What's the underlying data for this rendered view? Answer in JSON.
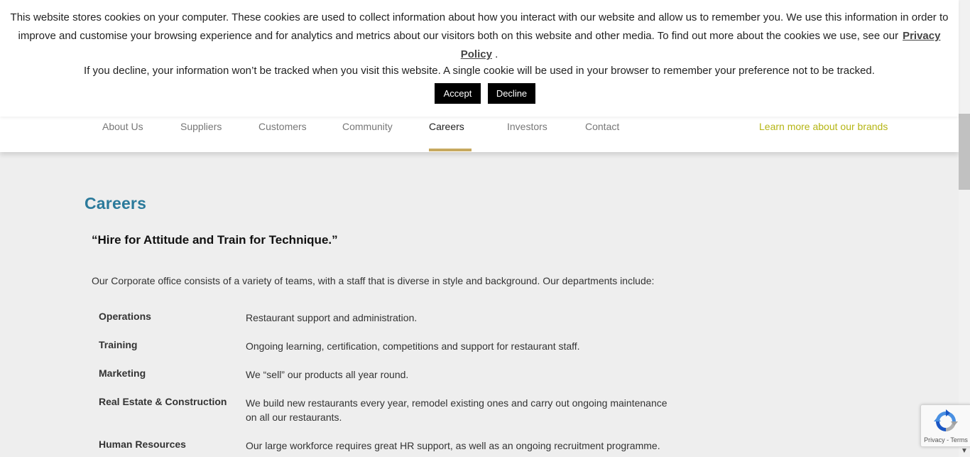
{
  "cookie_banner": {
    "text_line1": "This website stores cookies on your computer. These cookies are used to collect information about how you interact with our website and allow us to remember you. We use this information in order to improve and customise your browsing experience and for analytics and metrics about our visitors both on this website and other media. To find out more about the cookies we use, see our",
    "privacy_link": "Privacy Policy",
    "period": ".",
    "text_line2": "If you decline, your information won’t be tracked when you visit this website. A single cookie will be used in your browser to remember your preference not to be tracked.",
    "accept_label": "Accept",
    "decline_label": "Decline"
  },
  "nav": {
    "items": [
      {
        "label": "About Us"
      },
      {
        "label": "Suppliers"
      },
      {
        "label": "Customers"
      },
      {
        "label": "Community"
      },
      {
        "label": "Careers",
        "active": true
      },
      {
        "label": "Investors"
      },
      {
        "label": "Contact"
      }
    ],
    "brands_link": "Learn more about our brands"
  },
  "main": {
    "title": "Careers",
    "quote": "“Hire for Attitude and Train for Technique.”",
    "intro": "Our Corporate office consists of a variety of teams, with a staff that is diverse in style and background. Our departments include:",
    "departments": [
      {
        "name": "Operations",
        "description": "Restaurant support and administration."
      },
      {
        "name": "Training",
        "description": "Ongoing learning, certification, competitions and support for restaurant staff."
      },
      {
        "name": "Marketing",
        "description": "We “sell” our products all year round."
      },
      {
        "name": "Real Estate & Construction",
        "description": "We build new restaurants every year, remodel existing ones and carry out ongoing maintenance on all our restaurants."
      },
      {
        "name": "Human Resources",
        "description": "Our large workforce requires great HR support, as well as an ongoing recruitment programme."
      }
    ]
  },
  "recaptcha": {
    "terms": "Privacy - Terms"
  },
  "colors": {
    "title": "#2b7a9b",
    "active_underline": "#c7a95f",
    "brands_link": "#b5b514"
  }
}
